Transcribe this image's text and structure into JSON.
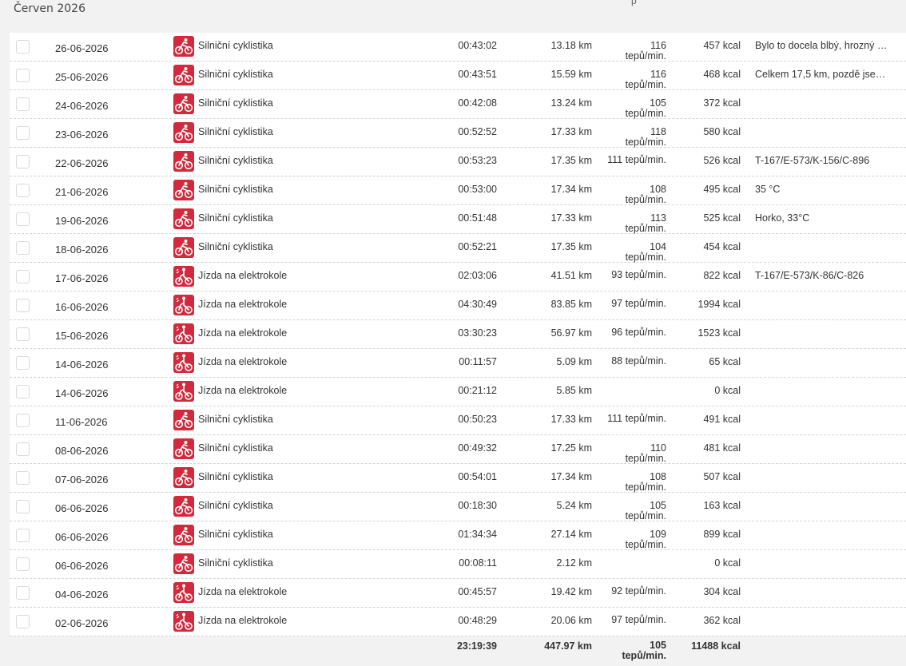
{
  "header": {
    "month": "Červen 2026",
    "top_mark": "p"
  },
  "workouts": [
    {
      "date": "26-06-2026",
      "sport": "Silniční cyklistika",
      "icon": "road-bike-icon",
      "time": "00:43:02",
      "distance": "13.18 km",
      "hr": "116 tepů/min.",
      "hr_value": "116",
      "hr_unit": "tepů/min.",
      "kcal": "457 kcal",
      "note": "Bylo to docela blbý, hrozný …"
    },
    {
      "date": "25-06-2026",
      "sport": "Silniční cyklistika",
      "icon": "road-bike-icon",
      "time": "00:43:51",
      "distance": "15.59 km",
      "hr_value": "116",
      "hr_unit": "tepů/min.",
      "kcal": "468 kcal",
      "note": "Celkem 17,5 km, pozdě jse…"
    },
    {
      "date": "24-06-2026",
      "sport": "Silniční cyklistika",
      "icon": "road-bike-icon",
      "time": "00:42:08",
      "distance": "13.24 km",
      "hr_value": "105",
      "hr_unit": "tepů/min.",
      "kcal": "372 kcal",
      "note": ""
    },
    {
      "date": "23-06-2026",
      "sport": "Silniční cyklistika",
      "icon": "road-bike-icon",
      "time": "00:52:52",
      "distance": "17.33 km",
      "hr_value": "118",
      "hr_unit": "tepů/min.",
      "kcal": "580 kcal",
      "note": ""
    },
    {
      "date": "22-06-2026",
      "sport": "Silniční cyklistika",
      "icon": "road-bike-icon",
      "time": "00:53:23",
      "distance": "17.35 km",
      "hr_single": "111 tepů/min.",
      "kcal": "526 kcal",
      "note": "T-167/E-573/K-156/C-896"
    },
    {
      "date": "21-06-2026",
      "sport": "Silniční cyklistika",
      "icon": "road-bike-icon",
      "time": "00:53:00",
      "distance": "17.34 km",
      "hr_value": "108",
      "hr_unit": "tepů/min.",
      "kcal": "495 kcal",
      "note": "35 °C"
    },
    {
      "date": "19-06-2026",
      "sport": "Silniční cyklistika",
      "icon": "road-bike-icon",
      "time": "00:51:48",
      "distance": "17.33 km",
      "hr_value": "113",
      "hr_unit": "tepů/min.",
      "kcal": "525 kcal",
      "note": "Horko, 33°C"
    },
    {
      "date": "18-06-2026",
      "sport": "Silniční cyklistika",
      "icon": "road-bike-icon",
      "time": "00:52:21",
      "distance": "17.35 km",
      "hr_value": "104",
      "hr_unit": "tepů/min.",
      "kcal": "454 kcal",
      "note": ""
    },
    {
      "date": "17-06-2026",
      "sport": "Jízda na elektrokole",
      "icon": "e-bike-icon",
      "time": "02:03:06",
      "distance": "41.51 km",
      "hr_single": "93 tepů/min.",
      "kcal": "822 kcal",
      "note": "T-167/E-573/K-86/C-826"
    },
    {
      "date": "16-06-2026",
      "sport": "Jízda na elektrokole",
      "icon": "e-bike-icon",
      "time": "04:30:49",
      "distance": "83.85 km",
      "hr_single": "97 tepů/min.",
      "kcal": "1994 kcal",
      "note": ""
    },
    {
      "date": "15-06-2026",
      "sport": "Jízda na elektrokole",
      "icon": "e-bike-icon",
      "time": "03:30:23",
      "distance": "56.97 km",
      "hr_single": "96 tepů/min.",
      "kcal": "1523 kcal",
      "note": ""
    },
    {
      "date": "14-06-2026",
      "sport": "Jízda na elektrokole",
      "icon": "e-bike-icon",
      "time": "00:11:57",
      "distance": "5.09 km",
      "hr_single": "88 tepů/min.",
      "kcal": "65 kcal",
      "note": ""
    },
    {
      "date": "14-06-2026",
      "sport": "Jízda na elektrokole",
      "icon": "e-bike-icon",
      "time": "00:21:12",
      "distance": "5.85 km",
      "hr_single": "",
      "kcal": "0 kcal",
      "note": ""
    },
    {
      "date": "11-06-2026",
      "sport": "Silniční cyklistika",
      "icon": "road-bike-icon",
      "time": "00:50:23",
      "distance": "17.33 km",
      "hr_single": "111 tepů/min.",
      "kcal": "491 kcal",
      "note": ""
    },
    {
      "date": "08-06-2026",
      "sport": "Silniční cyklistika",
      "icon": "road-bike-icon",
      "time": "00:49:32",
      "distance": "17.25 km",
      "hr_value": "110",
      "hr_unit": "tepů/min.",
      "kcal": "481 kcal",
      "note": ""
    },
    {
      "date": "07-06-2026",
      "sport": "Silniční cyklistika",
      "icon": "road-bike-icon",
      "time": "00:54:01",
      "distance": "17.34 km",
      "hr_value": "108",
      "hr_unit": "tepů/min.",
      "kcal": "507 kcal",
      "note": ""
    },
    {
      "date": "06-06-2026",
      "sport": "Silniční cyklistika",
      "icon": "road-bike-icon",
      "time": "00:18:30",
      "distance": "5.24 km",
      "hr_value": "105",
      "hr_unit": "tepů/min.",
      "kcal": "163 kcal",
      "note": ""
    },
    {
      "date": "06-06-2026",
      "sport": "Silniční cyklistika",
      "icon": "road-bike-icon",
      "time": "01:34:34",
      "distance": "27.14 km",
      "hr_value": "109",
      "hr_unit": "tepů/min.",
      "kcal": "899 kcal",
      "note": ""
    },
    {
      "date": "06-06-2026",
      "sport": "Silniční cyklistika",
      "icon": "road-bike-icon",
      "time": "00:08:11",
      "distance": "2.12 km",
      "hr_single": "",
      "kcal": "0 kcal",
      "note": ""
    },
    {
      "date": "04-06-2026",
      "sport": "Jízda na elektrokole",
      "icon": "e-bike-icon",
      "time": "00:45:57",
      "distance": "19.42 km",
      "hr_single": "92 tepů/min.",
      "kcal": "304 kcal",
      "note": ""
    },
    {
      "date": "02-06-2026",
      "sport": "Jízda na elektrokole",
      "icon": "e-bike-icon",
      "time": "00:48:29",
      "distance": "20.06 km",
      "hr_single": "97 tepů/min.",
      "kcal": "362 kcal",
      "note": ""
    }
  ],
  "totals": {
    "time": "23:19:39",
    "distance": "447.97 km",
    "hr_value": "105",
    "hr_unit": "tepů/min.",
    "kcal": "11488 kcal"
  },
  "colors": {
    "icon_bg": "#d22a3c",
    "row_bg": "#ffffff",
    "page_bg": "#f2f2f2"
  }
}
